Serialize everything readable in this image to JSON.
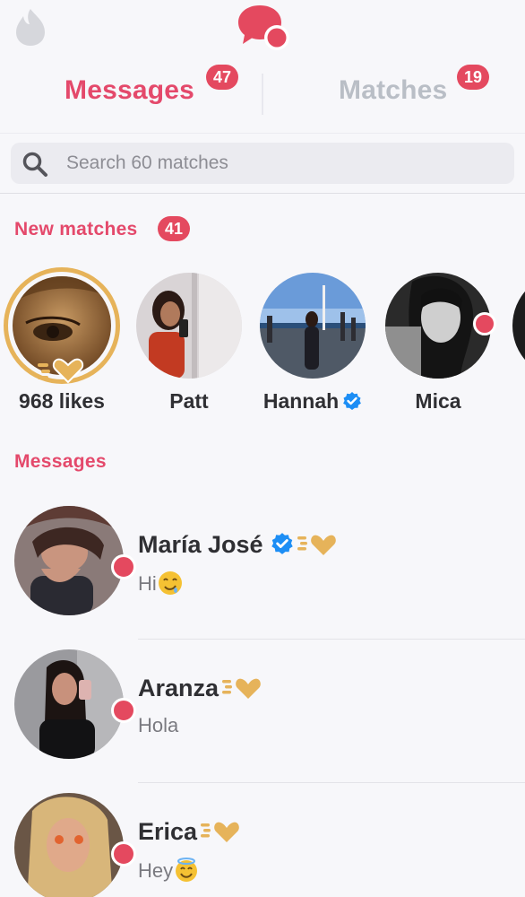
{
  "header": {
    "app_icon": "flame-icon",
    "logo_icon": "chat-bubbles-icon"
  },
  "tabs": {
    "messages_label": "Messages",
    "messages_count": "47",
    "matches_label": "Matches",
    "matches_count": "19"
  },
  "search": {
    "placeholder": "Search 60 matches"
  },
  "new_matches": {
    "title": "New matches",
    "count": "41",
    "items": [
      {
        "label": "968 likes"
      },
      {
        "label": "Patt"
      },
      {
        "label": "Hannah"
      },
      {
        "label": "Mica"
      }
    ]
  },
  "messages": {
    "title": "Messages",
    "items": [
      {
        "name": "María José",
        "preview": "Hi"
      },
      {
        "name": "Aranza",
        "preview": "Hola"
      },
      {
        "name": "Erica",
        "preview": "Hey"
      }
    ]
  },
  "colors": {
    "accent": "#e4496b",
    "badge": "#e4495f",
    "gold": "#e6b35a",
    "verified": "#1d8ef5"
  }
}
